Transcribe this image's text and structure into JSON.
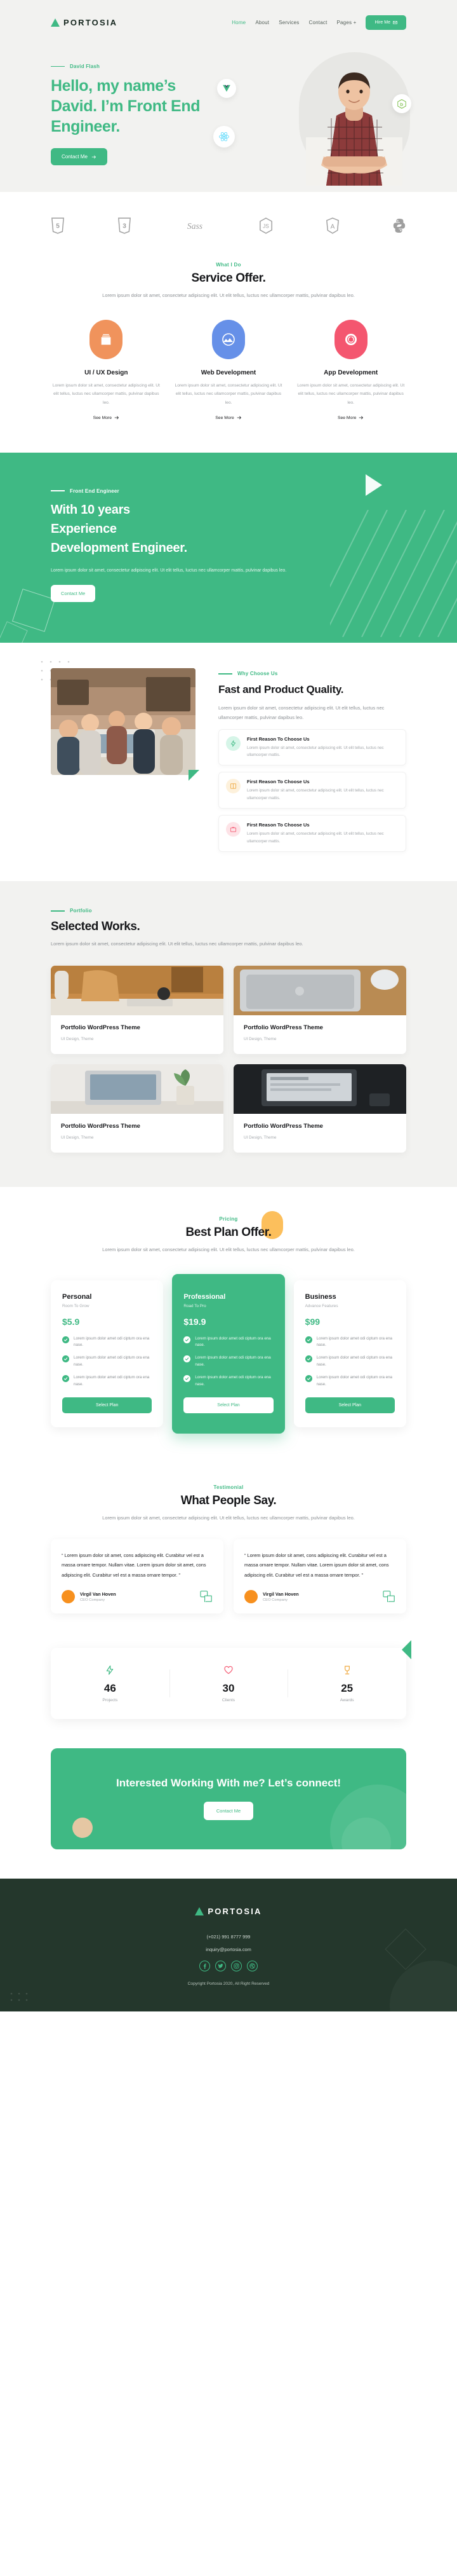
{
  "brand": {
    "name": "PORTOSIA",
    "logo_icon": "triangle-logo"
  },
  "nav": {
    "items": [
      {
        "label": "Home",
        "active": true
      },
      {
        "label": "About",
        "active": false
      },
      {
        "label": "Services",
        "active": false
      },
      {
        "label": "Contact",
        "active": false
      },
      {
        "label": "Pages +",
        "active": false
      }
    ],
    "cta_label": "Hire Me",
    "cta_icon": "envelope-icon"
  },
  "hero": {
    "eyebrow": "David Flash",
    "heading": "Hello, my name’s David. I’m Front End Engineer.",
    "button": "Contact Me",
    "badges": [
      "vue-icon",
      "react-icon",
      "node-icon"
    ]
  },
  "tech": {
    "items": [
      "html5-icon",
      "css3-icon",
      "sass-icon",
      "javascript-icon",
      "angular-icon",
      "python-icon"
    ]
  },
  "services": {
    "kicker": "What I Do",
    "title": "Service Offer.",
    "lead": "Lorem ipsum dolor sit amet, consectetur adipiscing elit. Ut elit tellus, luctus nec ullamcorper mattis, pulvinar dapibus leo.",
    "more_label": "See More",
    "cards": [
      {
        "title": "UI / UX Design",
        "text": "Lorem ipsum dolor sit amet, consectetur adipiscing elit. Ut elit tellus, luctus nec ullamcorper mattis, pulvinar dapibus leo.",
        "color": "#f0935c",
        "icon": "layers-icon"
      },
      {
        "title": "Web Development",
        "text": "Lorem ipsum dolor sit amet, consectetur adipiscing elit. Ut elit tellus, luctus nec ullamcorper mattis, pulvinar dapibus leo.",
        "color": "#6690e8",
        "icon": "image-icon"
      },
      {
        "title": "App Development",
        "text": "Lorem ipsum dolor sit amet, consectetur adipiscing elit. Ut elit tellus, luctus nec ullamcorper mattis, pulvinar dapibus leo.",
        "color": "#f4566f",
        "icon": "gear-icon"
      }
    ]
  },
  "experience": {
    "eyebrow": "Front End Engineer",
    "title": "With 10 years Experience Development Engineer.",
    "text": "Lorem ipsum dolor sit amet, consectetur adipiscing elit. Ut elit tellus, luctus nec ullamcorper mattis, pulvinar dapibus leo.",
    "button": "Contact Me",
    "play_icon": "play-triangle-icon"
  },
  "why": {
    "kicker": "Why Choose Us",
    "title": "Fast and Product Quality.",
    "lead": "Lorem ipsum dolor sit amet, consectetur adipiscing elit. Ut elit tellus, luctus nec ullamcorper mattis, pulvinar dapibus leo.",
    "reasons": [
      {
        "title": "First Reason To Choose Us",
        "text": "Lorem ipsum dolor sit amet, consectetur adipiscing elit. Ut elit tellus, luctus nec ullamcorper mattis.",
        "icon": "bolt-icon",
        "bg": "#d6f5e8",
        "fg": "#3fb984"
      },
      {
        "title": "First Reason To Choose Us",
        "text": "Lorem ipsum dolor sit amet, consectetur adipiscing elit. Ut elit tellus, luctus nec ullamcorper mattis.",
        "icon": "book-icon",
        "bg": "#fdf1dc",
        "fg": "#efa83c"
      },
      {
        "title": "First Reason To Choose Us",
        "text": "Lorem ipsum dolor sit amet, consectetur adipiscing elit. Ut elit tellus, luctus nec ullamcorper mattis.",
        "icon": "briefcase-icon",
        "bg": "#fde3e7",
        "fg": "#f4566f"
      }
    ]
  },
  "portfolio": {
    "kicker": "Portfolio",
    "title": "Selected Works.",
    "lead": "Lorem ipsum dolor sit amet, consectetur adipiscing elit. Ut elit tellus, luctus nec ullamcorper mattis, pulvinar dapibus leo.",
    "items": [
      {
        "title": "Portfolio WordPress Theme",
        "tags": "UI Design, Theme",
        "thumb": "desk-chair-photo"
      },
      {
        "title": "Portfolio WordPress Theme",
        "tags": "UI Design, Theme",
        "thumb": "macbook-mouse-photo"
      },
      {
        "title": "Portfolio WordPress Theme",
        "tags": "UI Design, Theme",
        "thumb": "laptop-plant-photo"
      },
      {
        "title": "Portfolio WordPress Theme",
        "tags": "UI Design, Theme",
        "thumb": "dark-laptop-photo"
      }
    ]
  },
  "pricing": {
    "kicker": "Pricing",
    "title": "Best Plan Offer.",
    "lead": "Lorem ipsum dolor sit amet, consectetur adipiscing elit. Ut elit tellus, luctus nec ullamcorper mattis, pulvinar dapibus leo.",
    "plans": [
      {
        "name": "Personal",
        "sub": "Room To Grow",
        "price": "$5.9",
        "featured": false,
        "features": [
          "Lorem ipsum dolor amet odi ciptum ora ena nase.",
          "Lorem ipsum dolor amet odi ciptum ora ena nase.",
          "Lorem ipsum dolor amet odi ciptum ora ena nase."
        ],
        "button": "Select Plan"
      },
      {
        "name": "Professional",
        "sub": "Road To Pro",
        "price": "$19.9",
        "featured": true,
        "features": [
          "Lorem ipsum dolor amet odi ciptum ora ena nase.",
          "Lorem ipsum dolor amet odi ciptum ora ena nase.",
          "Lorem ipsum dolor amet odi ciptum ora ena nase."
        ],
        "button": "Select Plan"
      },
      {
        "name": "Business",
        "sub": "Advance Features",
        "price": "$99",
        "featured": false,
        "features": [
          "Lorem ipsum dolor amet odi ciptum ora ena nase.",
          "Lorem ipsum dolor amet odi ciptum ora ena nase.",
          "Lorem ipsum dolor amet odi ciptum ora ena nase."
        ],
        "button": "Select Plan"
      }
    ]
  },
  "testimonial": {
    "kicker": "Testimonial",
    "title": "What People Say.",
    "lead": "Lorem ipsum dolor sit amet, consectetur adipiscing elit. Ut elit tellus, luctus nec ullamcorper mattis, pulvinar dapibus leo.",
    "items": [
      {
        "quote": "“ Lorem ipsum dolor sit amet, cons adipiscing elit. Curabitur vel est a massa ornare tempor. Nullam vitae. Lorem ipsum dolor sit amet, cons adipiscing elit. Curabitur vel est a massa ornare tempor. ”",
        "name": "Virgil Van Hoven",
        "role": "CEO Company"
      },
      {
        "quote": "“ Lorem ipsum dolor sit amet, cons adipiscing elit. Curabitur vel est a massa ornare tempor. Nullam vitae. Lorem ipsum dolor sit amet, cons adipiscing elit. Curabitur vel est a massa ornare tempor. ”",
        "name": "Virgil Van Hoven",
        "role": "CEO Company"
      }
    ]
  },
  "stats": [
    {
      "value": "46",
      "label": "Projects",
      "icon": "bolt-icon",
      "color": "#3fb984"
    },
    {
      "value": "30",
      "label": "Clients",
      "icon": "heart-icon",
      "color": "#f4566f"
    },
    {
      "value": "25",
      "label": "Awards",
      "icon": "trophy-icon",
      "color": "#efa83c"
    }
  ],
  "cta": {
    "title": "Interested Working With me? Let’s connect!",
    "button": "Contact Me"
  },
  "footer": {
    "brand": "PORTOSIA",
    "phone": "(+021) 991 8777 999",
    "email": "inquiry@portosia.com",
    "socials": [
      "facebook-icon",
      "twitter-icon",
      "instagram-icon",
      "dribbble-icon"
    ],
    "copyright": "Copyright Portosia 2020, All Right Reserved"
  },
  "colors": {
    "accent": "#3fb984",
    "dark": "#24372c",
    "heroBg": "#f2f2f0"
  }
}
